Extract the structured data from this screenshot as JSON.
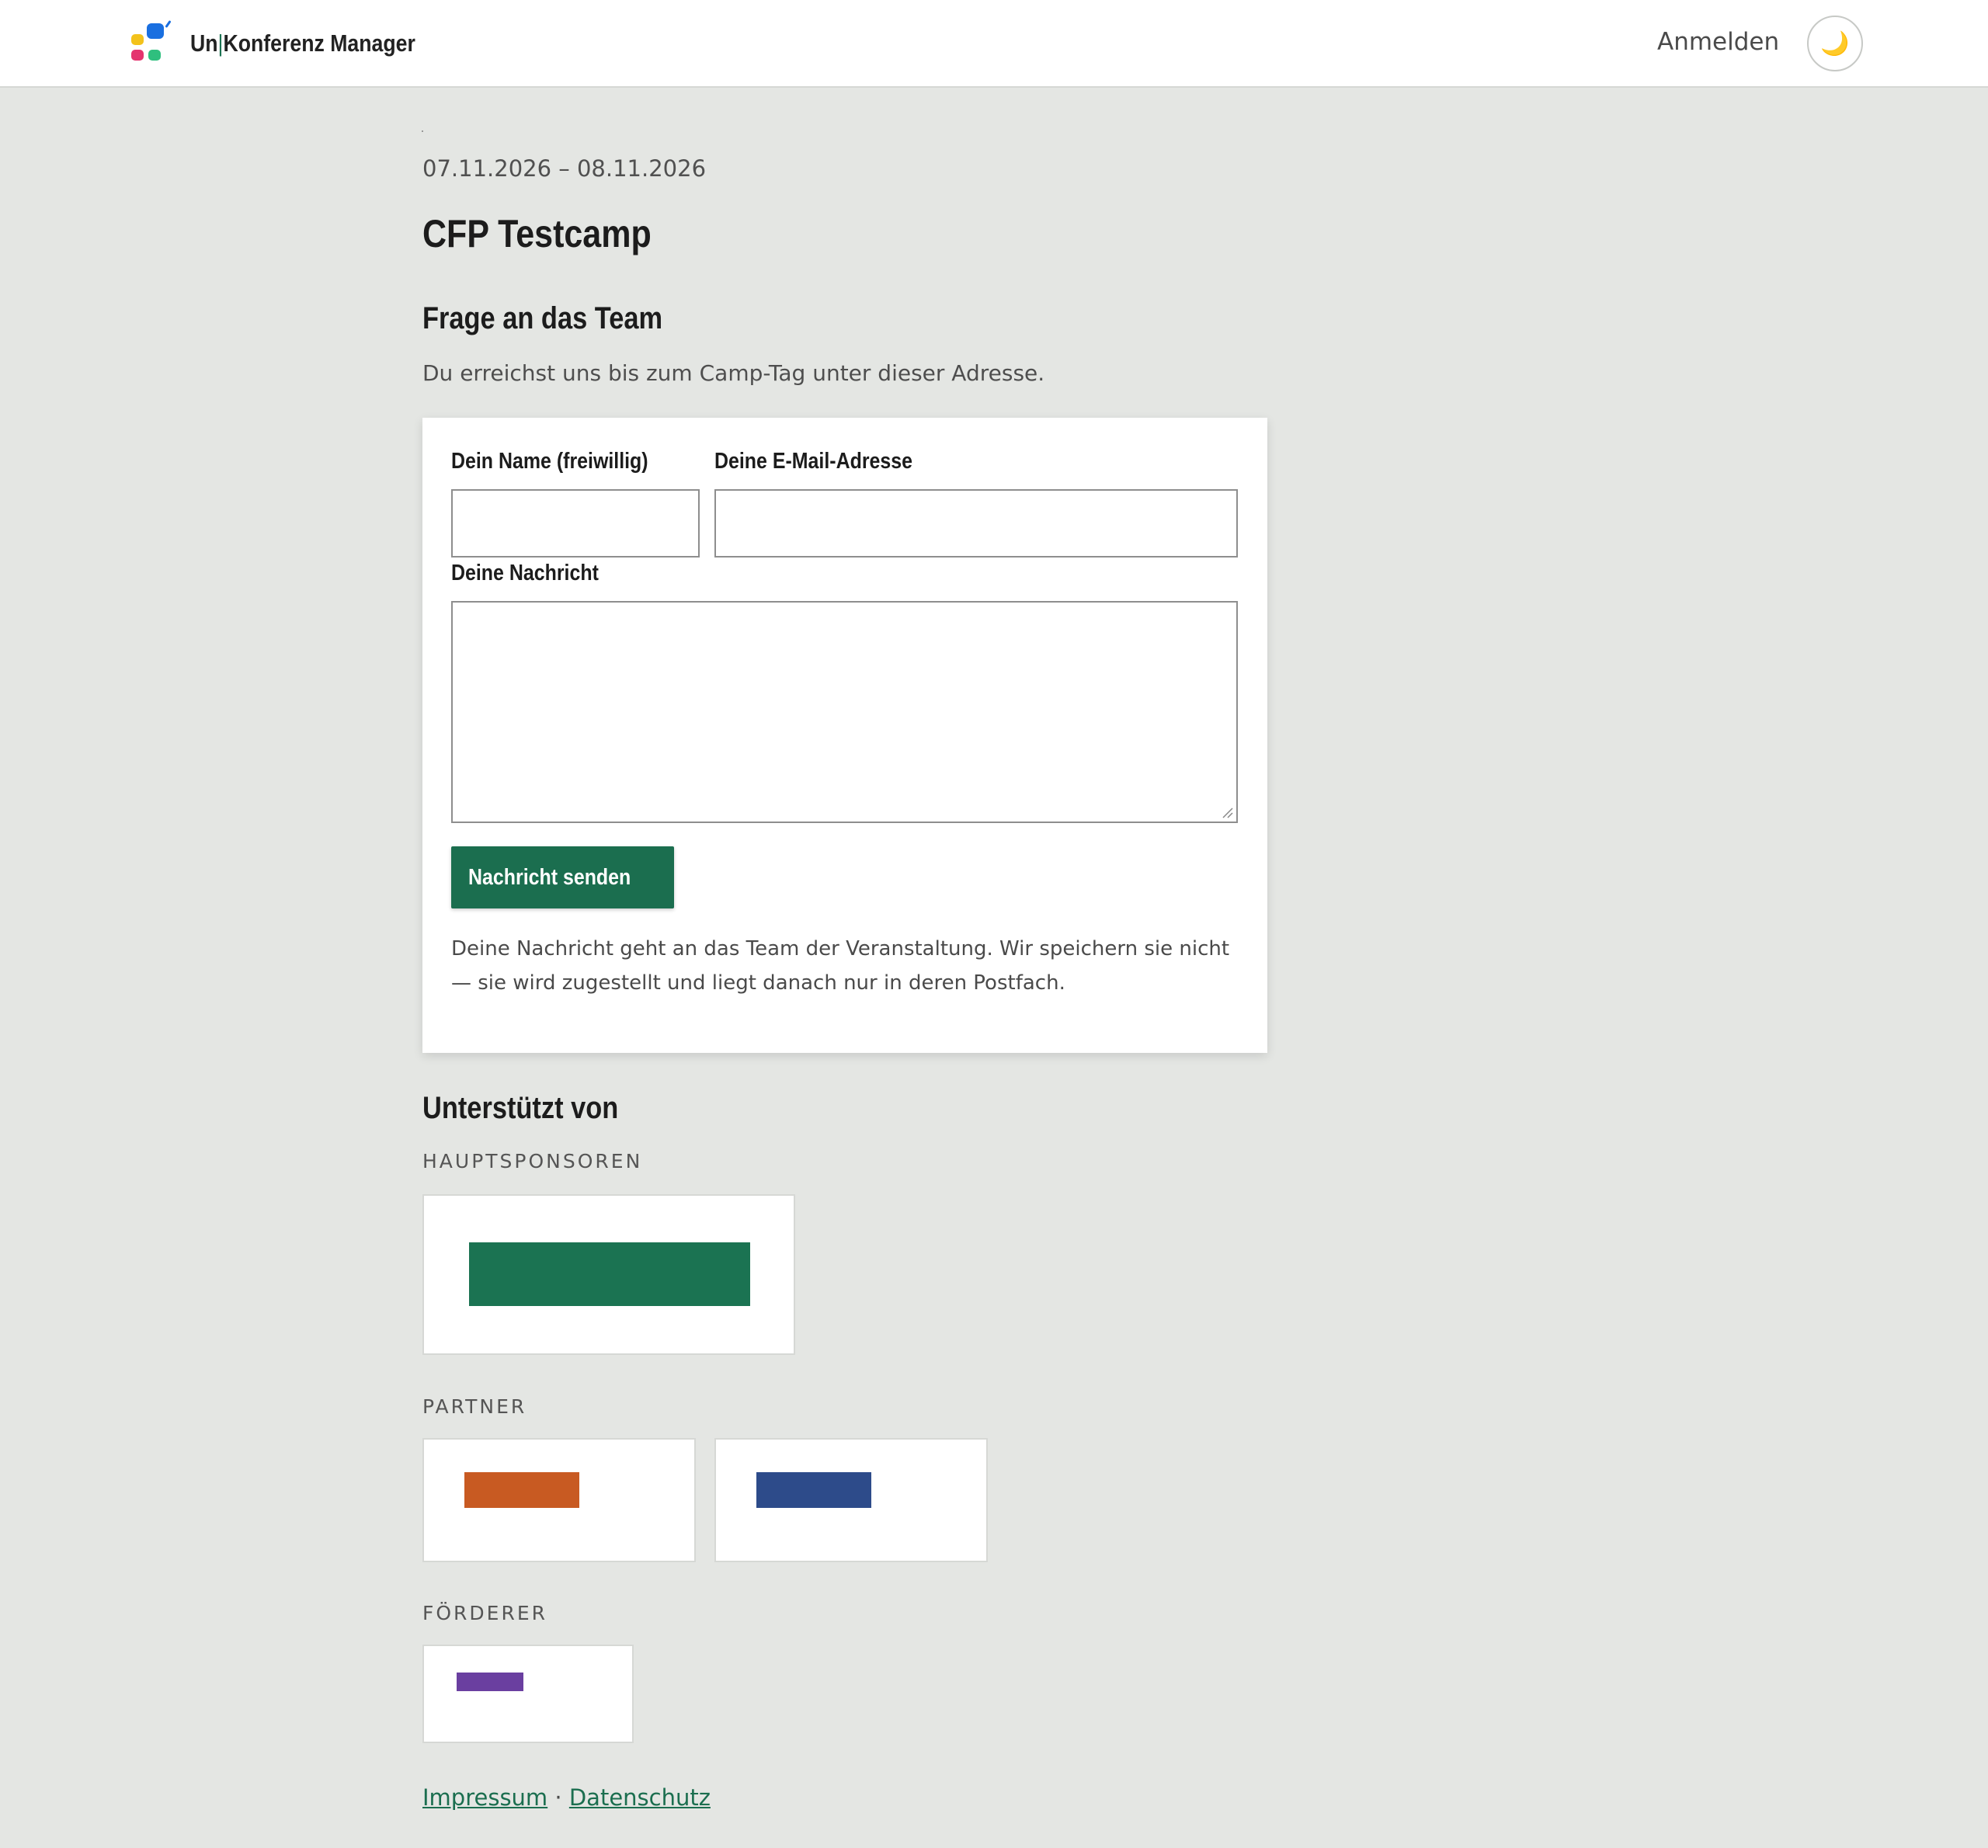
{
  "header": {
    "brand_prefix": "Un",
    "brand_separator": "|",
    "brand_suffix": "Konferenz Manager",
    "login_label": "Anmelden",
    "theme_icon": "🌙"
  },
  "event": {
    "date_range": "07.11.2026 – 08.11.2026",
    "title": "CFP Testcamp"
  },
  "contact": {
    "heading": "Frage an das Team",
    "intro": "Du erreichst uns bis zum Camp-Tag unter dieser Adresse.",
    "name_label": "Dein Name (freiwillig)",
    "name_value": "",
    "email_label": "Deine E-Mail-Adresse",
    "email_value": "",
    "message_label": "Deine Nachricht",
    "message_value": "",
    "send_label": "Nachricht senden",
    "privacy_note": "Deine Nachricht geht an das Team der Veranstaltung. Wir speichern sie nicht — sie wird zugestellt und liegt danach nur in deren Postfach."
  },
  "sponsors": {
    "heading": "Unterstützt von",
    "main_label": "HAUPTSPONSOREN",
    "partner_label": "PARTNER",
    "supporter_label": "FÖRDERER",
    "colors": {
      "main": "#1b7352",
      "partner_1": "#c85a22",
      "partner_2": "#2d4b8a",
      "supporter": "#6a3fa0"
    }
  },
  "footer": {
    "imprint": "Impressum",
    "separator": "·",
    "privacy": "Datenschutz"
  },
  "colors": {
    "accent": "#1b6e4f",
    "background": "#e4e6e3"
  }
}
